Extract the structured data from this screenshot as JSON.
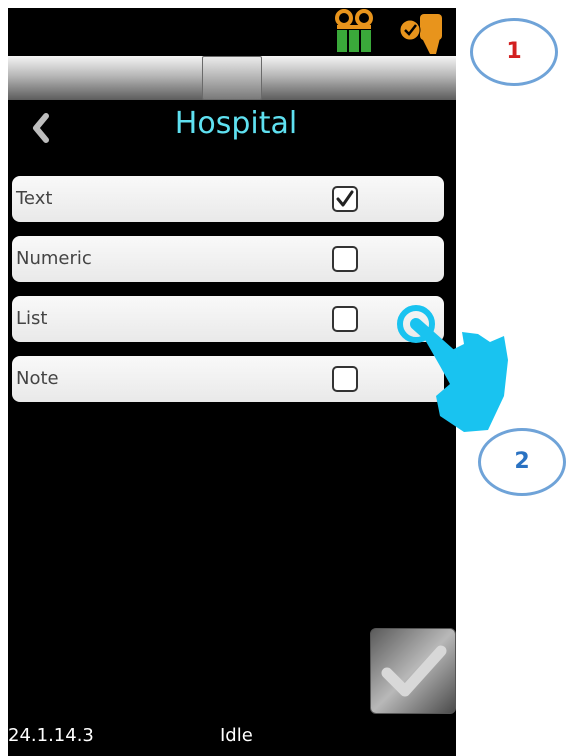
{
  "header": {
    "title": "Hospital"
  },
  "icons": {
    "tape": "cassette-tape-icon",
    "probe": "probe-ready-icon",
    "back": "chevron-left-icon",
    "confirm": "checkmark-icon",
    "pointer": "hand-pointer-icon"
  },
  "options": [
    {
      "label": "Text",
      "checked": true
    },
    {
      "label": "Numeric",
      "checked": false
    },
    {
      "label": "List",
      "checked": false
    },
    {
      "label": "Note",
      "checked": false
    }
  ],
  "footer": {
    "version": "24.1.14.3",
    "status": "Idle"
  },
  "callouts": [
    {
      "label": "1"
    },
    {
      "label": "2"
    }
  ],
  "colors": {
    "title": "#5fe0f0",
    "icon_orange": "#e8941c",
    "icon_green": "#3aa83a",
    "callout_1_text": "#d32020",
    "callout_2_text": "#2a72c2",
    "callout_border": "#6fa3d8",
    "hand": "#19c3f0"
  }
}
